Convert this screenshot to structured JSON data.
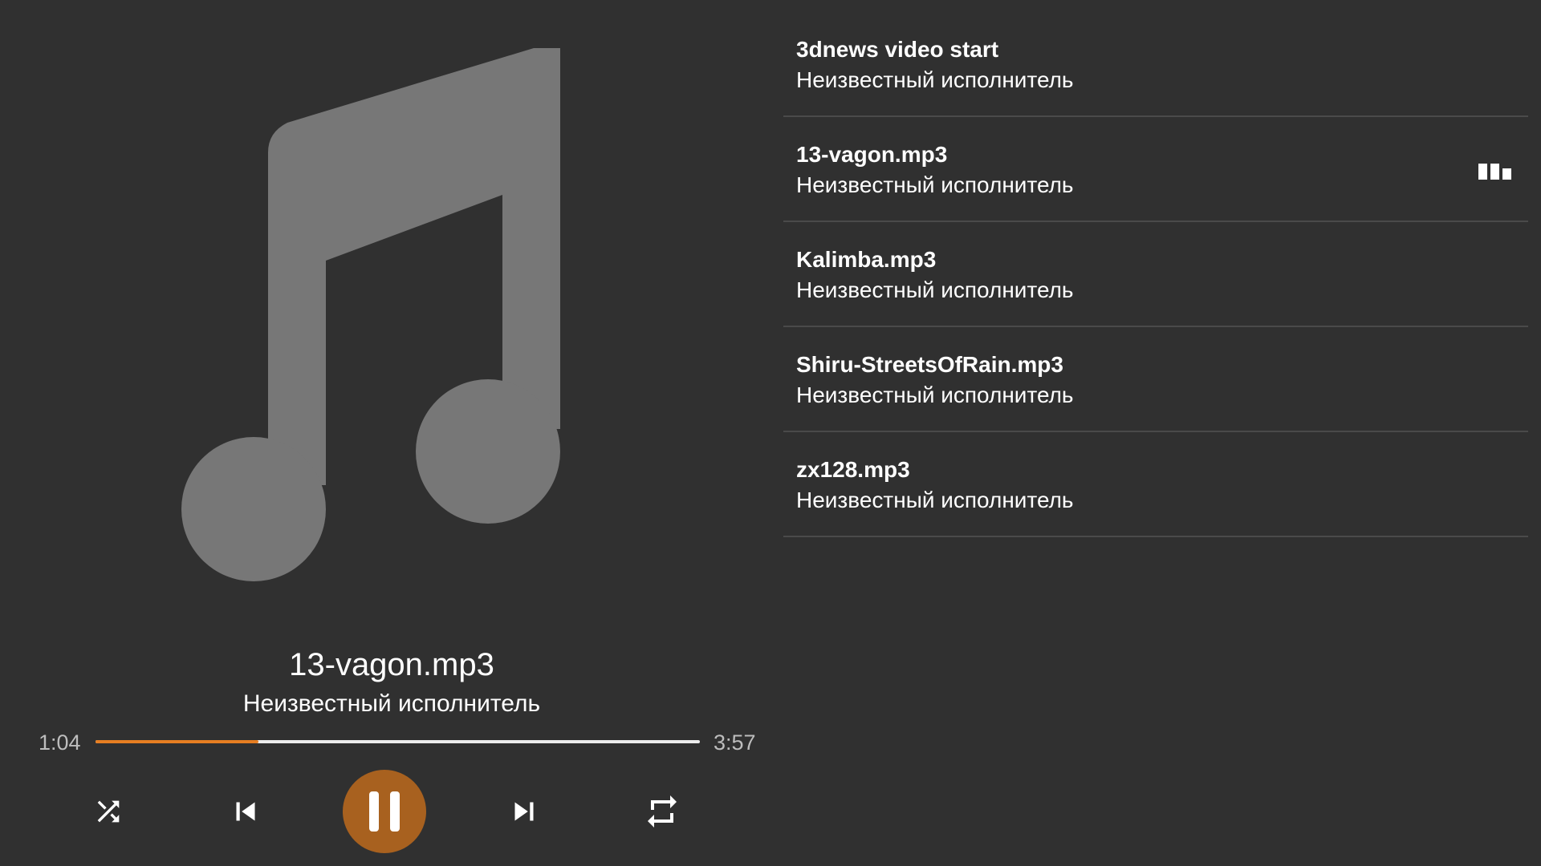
{
  "player": {
    "artwork_icon": "music-note-icon",
    "title": "13-vagon.mp3",
    "artist": "Неизвестный исполнитель",
    "elapsed": "1:04",
    "duration": "3:57",
    "progress_fraction": 0.27,
    "controls": {
      "shuffle_icon": "shuffle-icon",
      "prev_icon": "skip-previous-icon",
      "play_pause_icon": "pause-icon",
      "next_icon": "skip-next-icon",
      "repeat_icon": "repeat-icon"
    }
  },
  "colors": {
    "background": "#303030",
    "accent": "#e67e22",
    "play_button": "#a8611f",
    "artwork": "#777777",
    "divider": "#4a4a4a"
  },
  "playlist": {
    "items": [
      {
        "title": "3dnews video start",
        "artist": "Неизвестный исполнитель",
        "playing": false
      },
      {
        "title": "13-vagon.mp3",
        "artist": "Неизвестный исполнитель",
        "playing": true
      },
      {
        "title": "Kalimba.mp3",
        "artist": "Неизвестный исполнитель",
        "playing": false
      },
      {
        "title": "Shiru-StreetsOfRain.mp3",
        "artist": "Неизвестный исполнитель",
        "playing": false
      },
      {
        "title": "zx128.mp3",
        "artist": "Неизвестный исполнитель",
        "playing": false
      }
    ],
    "playing_indicator_icon": "equalizer-icon"
  }
}
